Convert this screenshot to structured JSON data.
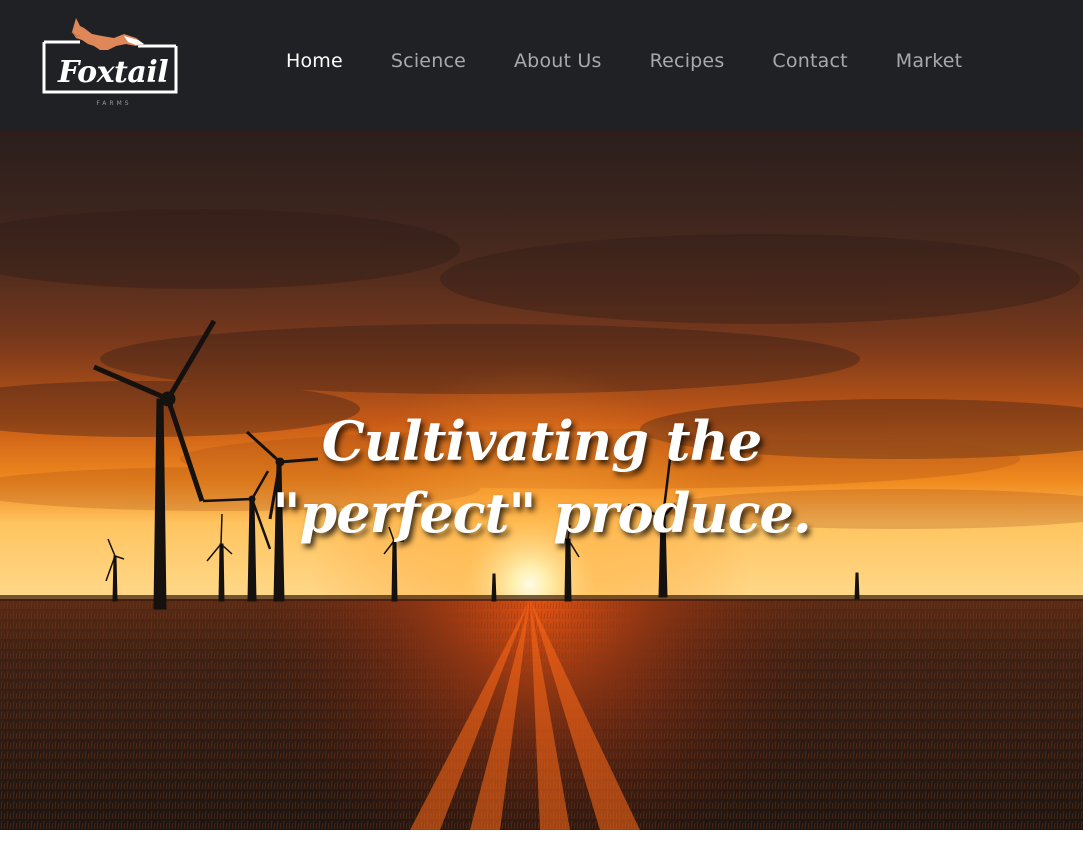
{
  "header": {
    "logo": {
      "name": "Foxtail",
      "tagline": "FARMS",
      "icon": "fox-icon",
      "accent_color": "#e0875a"
    },
    "nav": [
      {
        "label": "Home",
        "active": true
      },
      {
        "label": "Science",
        "active": false
      },
      {
        "label": "About Us",
        "active": false
      },
      {
        "label": "Recipes",
        "active": false
      },
      {
        "label": "Contact",
        "active": false
      },
      {
        "label": "Market",
        "active": false
      }
    ],
    "background_color": "#1f2125"
  },
  "hero": {
    "headline_line1": "Cultivating the",
    "headline_line2": "\"perfect\" produce.",
    "image": "sunset-wind-turbines-field"
  }
}
